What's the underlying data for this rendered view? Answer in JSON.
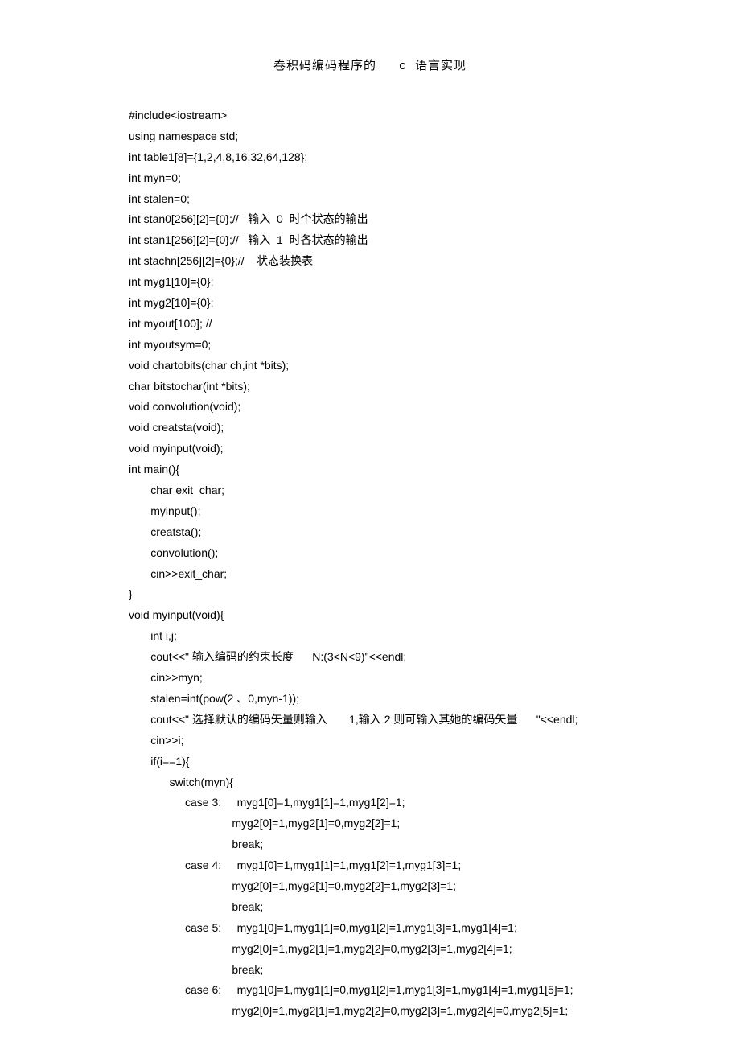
{
  "title_left": "卷积码编码程序的",
  "title_right": "c 语言实现",
  "code_lines": [
    "#include<iostream>",
    "using namespace std;",
    "int table1[8]={1,2,4,8,16,32,64,128};",
    "int myn=0;",
    "int stalen=0;",
    "int stan0[256][2]={0};//   输入  0  时个状态的输出",
    "int stan1[256][2]={0};//   输入  1  时各状态的输出",
    "int stachn[256][2]={0};//    状态装换表",
    "int myg1[10]={0};",
    "int myg2[10]={0};",
    "int myout[100]; //",
    "int myoutsym=0;",
    "void chartobits(char ch,int *bits);",
    "char bitstochar(int *bits);",
    "void convolution(void);",
    "void creatsta(void);",
    "void myinput(void);",
    "int main(){",
    "       char exit_char;",
    "       myinput();",
    "       creatsta();",
    "       convolution();",
    "       cin>>exit_char;",
    "}",
    "void myinput(void){",
    "       int i,j;",
    "       cout<<\" 输入编码的约束长度      N:(3<N<9)\"<<endl;",
    "       cin>>myn;",
    "       stalen=int(pow(2 、0,myn-1));",
    "       cout<<\" 选择默认的编码矢量则输入       1,输入 2 则可输入其她的编码矢量      \"<<endl;",
    "       cin>>i;",
    "       if(i==1){",
    "             switch(myn){",
    "                  case 3:     myg1[0]=1,myg1[1]=1,myg1[2]=1;",
    "                                 myg2[0]=1,myg2[1]=0,myg2[2]=1;",
    "                                 break;",
    "                  case 4:     myg1[0]=1,myg1[1]=1,myg1[2]=1,myg1[3]=1;",
    "                                 myg2[0]=1,myg2[1]=0,myg2[2]=1,myg2[3]=1;",
    "                                 break;",
    "                  case 5:     myg1[0]=1,myg1[1]=0,myg1[2]=1,myg1[3]=1,myg1[4]=1;",
    "                                 myg2[0]=1,myg2[1]=1,myg2[2]=0,myg2[3]=1,myg2[4]=1;",
    "                                 break;",
    "                  case 6:     myg1[0]=1,myg1[1]=0,myg1[2]=1,myg1[3]=1,myg1[4]=1,myg1[5]=1;",
    "                                 myg2[0]=1,myg2[1]=1,myg2[2]=0,myg2[3]=1,myg2[4]=0,myg2[5]=1;"
  ]
}
